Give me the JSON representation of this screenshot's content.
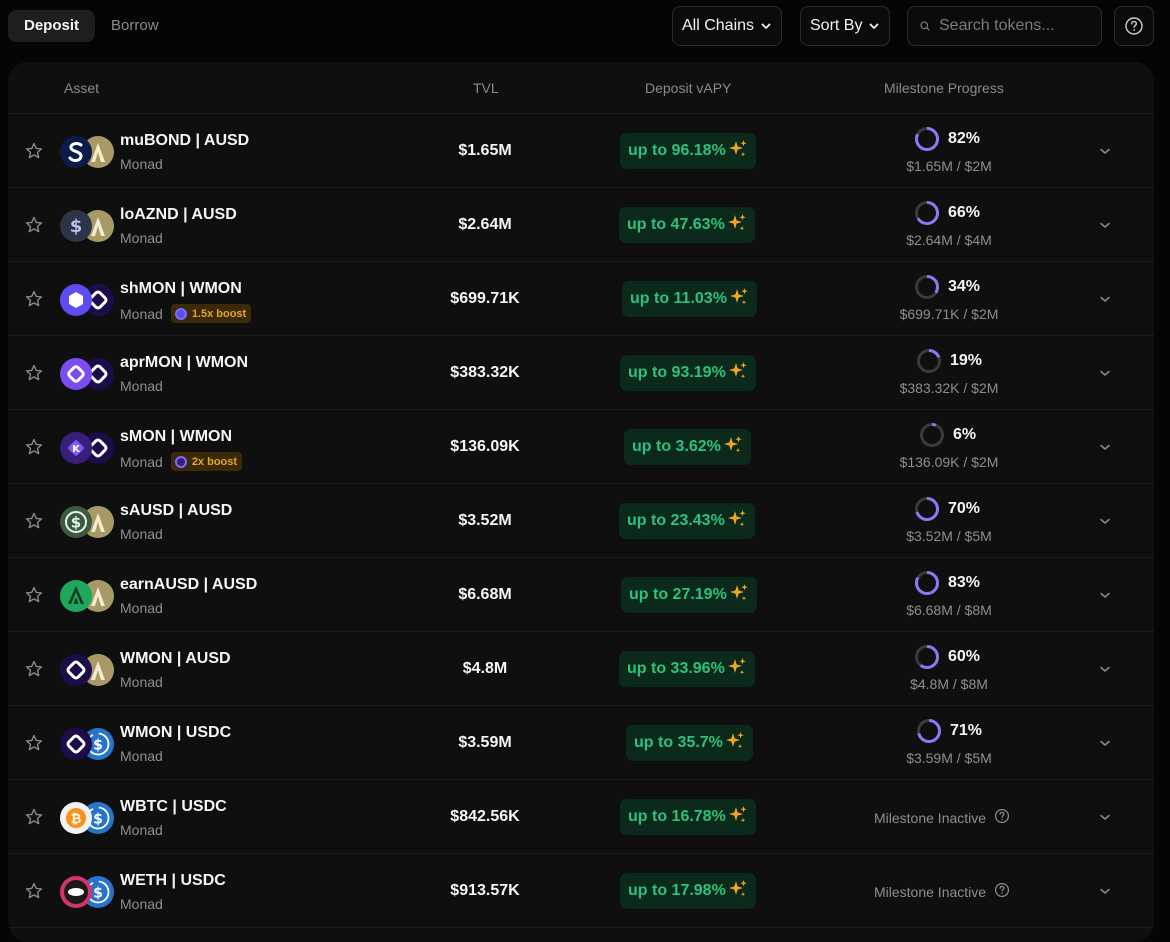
{
  "tabs": [
    {
      "label": "Deposit",
      "active": true
    },
    {
      "label": "Borrow",
      "active": false
    }
  ],
  "filters": {
    "chains_label": "All Chains",
    "sort_label": "Sort By",
    "search_placeholder": "Search tokens..."
  },
  "columns": {
    "asset": "Asset",
    "tvl": "TVL",
    "apy": "Deposit vAPY",
    "milestone": "Milestone Progress"
  },
  "colors": {
    "accent_green": "#2cc27b",
    "ring_purple": "#8a79f5",
    "boost_orange": "#e6a52a"
  },
  "rows": [
    {
      "pair": "muBOND | AUSD",
      "chain": "Monad",
      "tvl": "$1.65M",
      "apy": "up to 96.18%",
      "milestone_pct": "82%",
      "progress_fraction": 0.82,
      "progress_text": "$1.65M / $2M",
      "tok_a": "mubond",
      "tok_b": "ausd",
      "boost": null
    },
    {
      "pair": "loAZND | AUSD",
      "chain": "Monad",
      "tvl": "$2.64M",
      "apy": "up to 47.63%",
      "milestone_pct": "66%",
      "progress_fraction": 0.66,
      "progress_text": "$2.64M / $4M",
      "tok_a": "loaznd",
      "tok_b": "ausd",
      "boost": null
    },
    {
      "pair": "shMON | WMON",
      "chain": "Monad",
      "tvl": "$699.71K",
      "apy": "up to 11.03%",
      "milestone_pct": "34%",
      "progress_fraction": 0.34,
      "progress_text": "$699.71K / $2M",
      "tok_a": "shmon",
      "tok_b": "wmon",
      "boost": "1.5x boost"
    },
    {
      "pair": "aprMON | WMON",
      "chain": "Monad",
      "tvl": "$383.32K",
      "apy": "up to 93.19%",
      "milestone_pct": "19%",
      "progress_fraction": 0.19,
      "progress_text": "$383.32K / $2M",
      "tok_a": "aprmon",
      "tok_b": "wmon",
      "boost": null
    },
    {
      "pair": "sMON | WMON",
      "chain": "Monad",
      "tvl": "$136.09K",
      "apy": "up to 3.62%",
      "milestone_pct": "6%",
      "progress_fraction": 0.06,
      "progress_text": "$136.09K / $2M",
      "tok_a": "smon",
      "tok_b": "wmon",
      "boost": "2x boost"
    },
    {
      "pair": "sAUSD | AUSD",
      "chain": "Monad",
      "tvl": "$3.52M",
      "apy": "up to 23.43%",
      "milestone_pct": "70%",
      "progress_fraction": 0.7,
      "progress_text": "$3.52M / $5M",
      "tok_a": "sausd",
      "tok_b": "ausd",
      "boost": null
    },
    {
      "pair": "earnAUSD | AUSD",
      "chain": "Monad",
      "tvl": "$6.68M",
      "apy": "up to 27.19%",
      "milestone_pct": "83%",
      "progress_fraction": 0.83,
      "progress_text": "$6.68M / $8M",
      "tok_a": "earnausd",
      "tok_b": "ausd",
      "boost": null
    },
    {
      "pair": "WMON | AUSD",
      "chain": "Monad",
      "tvl": "$4.8M",
      "apy": "up to 33.96%",
      "milestone_pct": "60%",
      "progress_fraction": 0.6,
      "progress_text": "$4.8M / $8M",
      "tok_a": "wmon",
      "tok_b": "ausd",
      "boost": null
    },
    {
      "pair": "WMON | USDC",
      "chain": "Monad",
      "tvl": "$3.59M",
      "apy": "up to 35.7%",
      "milestone_pct": "71%",
      "progress_fraction": 0.71,
      "progress_text": "$3.59M / $5M",
      "tok_a": "wmon",
      "tok_b": "usdc",
      "boost": null
    },
    {
      "pair": "WBTC | USDC",
      "chain": "Monad",
      "tvl": "$842.56K",
      "apy": "up to 16.78%",
      "milestone_inactive": "Milestone Inactive",
      "tok_a": "wbtc",
      "tok_b": "usdc",
      "boost": null
    },
    {
      "pair": "WETH | USDC",
      "chain": "Monad",
      "tvl": "$913.57K",
      "apy": "up to 17.98%",
      "milestone_inactive": "Milestone Inactive",
      "tok_a": "weth",
      "tok_b": "usdc",
      "boost": null
    }
  ]
}
